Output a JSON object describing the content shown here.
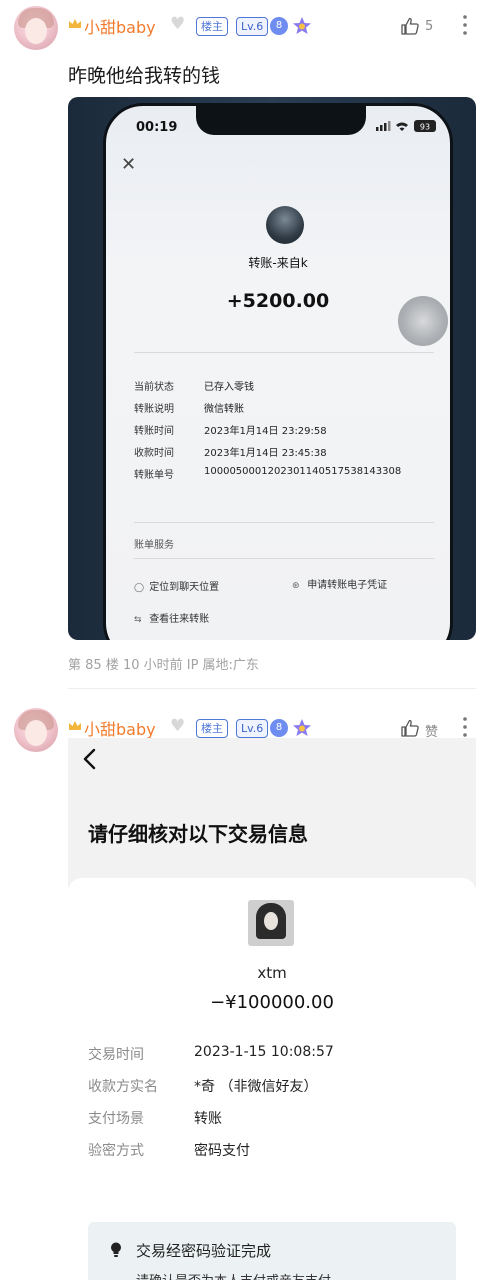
{
  "post1": {
    "username": "小甜baby",
    "host_badge": "楼主",
    "level_badge": "Lv.6",
    "shield_num": "8",
    "like_count": "5",
    "text": "昨晚他给我转的钱",
    "meta": "第 85 楼   10 小时前   IP 属地:广东"
  },
  "transfer_screen": {
    "time": "00:19",
    "battery": "93",
    "from": "转账-来自k",
    "amount": "+5200.00",
    "rows": [
      {
        "k": "当前状态",
        "v": "已存入零钱"
      },
      {
        "k": "转账说明",
        "v": "微信转账"
      },
      {
        "k": "转账时间",
        "v": "2023年1月14日 23:29:58"
      },
      {
        "k": "收款时间",
        "v": "2023年1月14日 23:45:38"
      },
      {
        "k": "转账单号",
        "v": "1000050001202301140517538143308"
      }
    ],
    "section": "账单服务",
    "opt_locate": "定位到聊天位置",
    "opt_voucher": "申请转账电子凭证",
    "opt_history": "查看往来转账"
  },
  "post2": {
    "username": "小甜baby",
    "host_badge": "楼主",
    "level_badge": "Lv.6",
    "shield_num": "8",
    "like_label": "赞"
  },
  "confirm_screen": {
    "title": "请仔细核对以下交易信息",
    "name": "xtm",
    "amount": "−¥100000.00",
    "rows": [
      {
        "k": "交易时间",
        "v": "2023-1-15 10:08:57"
      },
      {
        "k": "收款方实名",
        "v": "*奇 （非微信好友）"
      },
      {
        "k": "支付场景",
        "v": "转账"
      },
      {
        "k": "验密方式",
        "v": "密码支付"
      }
    ],
    "notice_title": "交易经密码验证完成",
    "notice_sub": "请确认是否为本人支付或亲友支付"
  },
  "colors": {
    "username": "#f27b2c",
    "badge_blue": "#4f77d6"
  }
}
